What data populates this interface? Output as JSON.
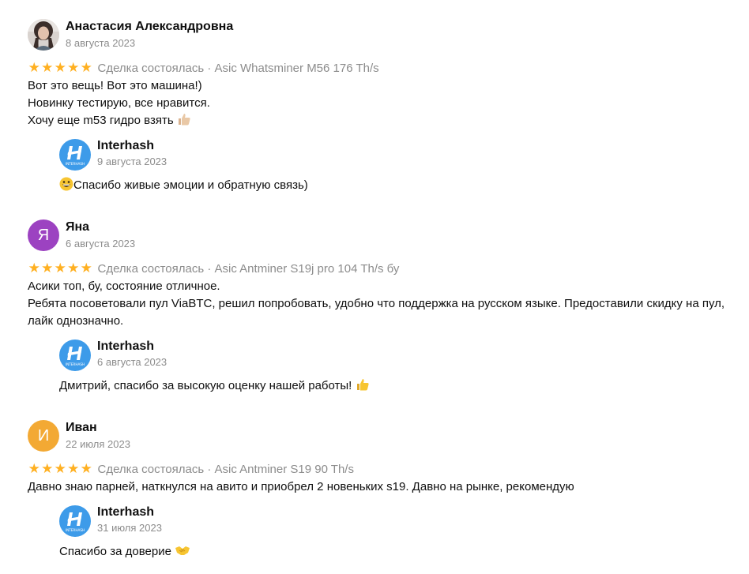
{
  "reviews": [
    {
      "avatar_type": "photo",
      "name": "Анастасия Александровна",
      "date": "8 августа 2023",
      "rating": 5,
      "meta": "Сделка состоялась · Asic Whatsminer M56 176 Th/s",
      "lines": [
        "Вот это вещь! Вот это машина!)",
        "Новинку тестирую, все нравится.",
        "Хочу еще m53 гидро взять"
      ],
      "reply": {
        "name": "Interhash",
        "date": "9 августа 2023",
        "text": "Спасибо живые эмоции и обратную связь)"
      }
    },
    {
      "avatar_letter": "Я",
      "avatar_color": "#9c42c1",
      "name": "Яна",
      "date": "6 августа 2023",
      "rating": 5,
      "meta": "Сделка состоялась · Asic Antminer S19j pro 104 Th/s бу",
      "lines": [
        "Асики топ, бу, состояние отличное.",
        "Ребята посоветовали пул ViaBTC, решил попробовать, удобно что поддержка на русском языке. Предоставили скидку на пул, лайк однозначно."
      ],
      "reply": {
        "name": "Interhash",
        "date": "6 августа 2023",
        "text": "Дмитрий, спасибо за высокую оценку нашей работы!"
      }
    },
    {
      "avatar_letter": "И",
      "avatar_color": "#f3a934",
      "name": "Иван",
      "date": "22 июля 2023",
      "rating": 5,
      "meta": "Сделка состоялась · Asic Antminer S19 90 Th/s",
      "lines": [
        "Давно знаю парней, наткнулся на авито и приобрел 2 новеньких s19. Давно на рынке, рекомендую"
      ],
      "reply": {
        "name": "Interhash",
        "date": "31 июля 2023",
        "text": "Спасибо за доверие"
      }
    }
  ],
  "brand": {
    "logo_text": "INTERHASH",
    "logo_color": "#3d9be9"
  },
  "colors": {
    "star": "#ffb021",
    "muted": "#8c8c8c"
  }
}
